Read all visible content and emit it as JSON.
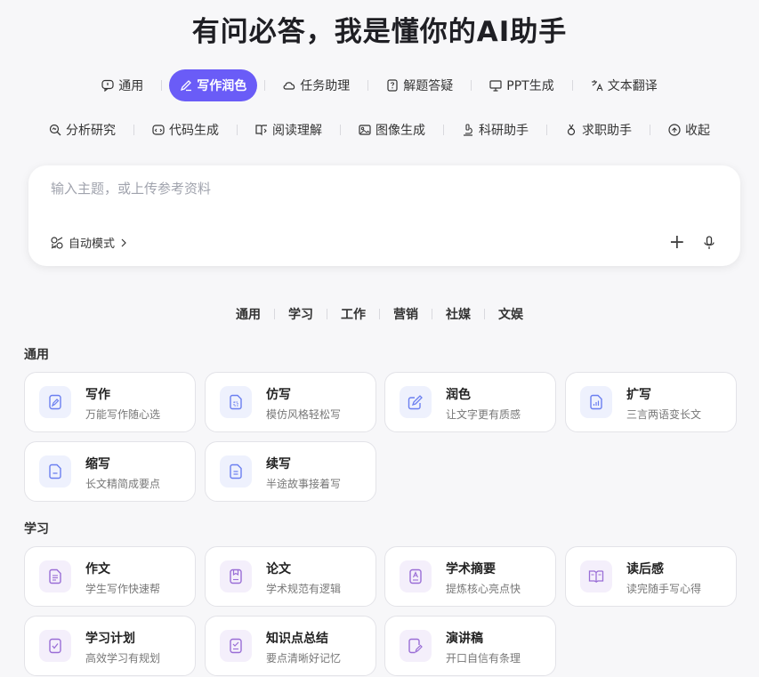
{
  "title": "有问必答，我是懂你的AI助手",
  "tabs_row1": [
    {
      "label": "通用",
      "icon": "chat-bubble-icon",
      "active": false
    },
    {
      "label": "写作润色",
      "icon": "pen-icon",
      "active": true
    },
    {
      "label": "任务助理",
      "icon": "cloud-icon",
      "active": false
    },
    {
      "label": "解题答疑",
      "icon": "question-doc-icon",
      "active": false
    },
    {
      "label": "PPT生成",
      "icon": "presentation-icon",
      "active": false
    },
    {
      "label": "文本翻译",
      "icon": "translate-icon",
      "active": false
    }
  ],
  "tabs_row2": [
    {
      "label": "分析研究",
      "icon": "magnifier-icon"
    },
    {
      "label": "代码生成",
      "icon": "code-icon"
    },
    {
      "label": "阅读理解",
      "icon": "book-icon"
    },
    {
      "label": "图像生成",
      "icon": "image-icon"
    },
    {
      "label": "科研助手",
      "icon": "microscope-icon"
    },
    {
      "label": "求职助手",
      "icon": "medal-icon"
    },
    {
      "label": "收起",
      "icon": "collapse-up-icon"
    }
  ],
  "input": {
    "placeholder": "输入主题，或上传参考资料",
    "mode_label": "自动模式",
    "plus": "+"
  },
  "categories": [
    "通用",
    "学习",
    "工作",
    "营销",
    "社媒",
    "文娱"
  ],
  "sections": [
    {
      "title": "通用",
      "cards": [
        {
          "name": "写作",
          "desc": "万能写作随心选",
          "icon": "writing-doc-icon"
        },
        {
          "name": "仿写",
          "desc": "模仿风格轻松写",
          "icon": "copy-doc-icon"
        },
        {
          "name": "润色",
          "desc": "让文字更有质感",
          "icon": "edit-icon"
        },
        {
          "name": "扩写",
          "desc": "三言两语变长文",
          "icon": "expand-doc-icon"
        },
        {
          "name": "缩写",
          "desc": "长文精简成要点",
          "icon": "shrink-doc-icon"
        },
        {
          "name": "续写",
          "desc": "半途故事接着写",
          "icon": "continue-doc-icon"
        }
      ]
    },
    {
      "title": "学习",
      "cards": [
        {
          "name": "作文",
          "desc": "学生写作快速帮",
          "icon": "essay-icon"
        },
        {
          "name": "论文",
          "desc": "学术规范有逻辑",
          "icon": "paper-icon"
        },
        {
          "name": "学术摘要",
          "desc": "提炼核心亮点快",
          "icon": "abstract-icon"
        },
        {
          "name": "读后感",
          "desc": "读完随手写心得",
          "icon": "open-book-icon"
        },
        {
          "name": "学习计划",
          "desc": "高效学习有规划",
          "icon": "plan-icon"
        },
        {
          "name": "知识点总结",
          "desc": "要点清晰好记忆",
          "icon": "summary-icon"
        },
        {
          "name": "演讲稿",
          "desc": "开口自信有条理",
          "icon": "speech-icon"
        }
      ]
    }
  ],
  "colors": {
    "accent": "#6a5cf7",
    "blue_icon": "#6b7ff0",
    "purple_icon": "#9a6ed6"
  }
}
